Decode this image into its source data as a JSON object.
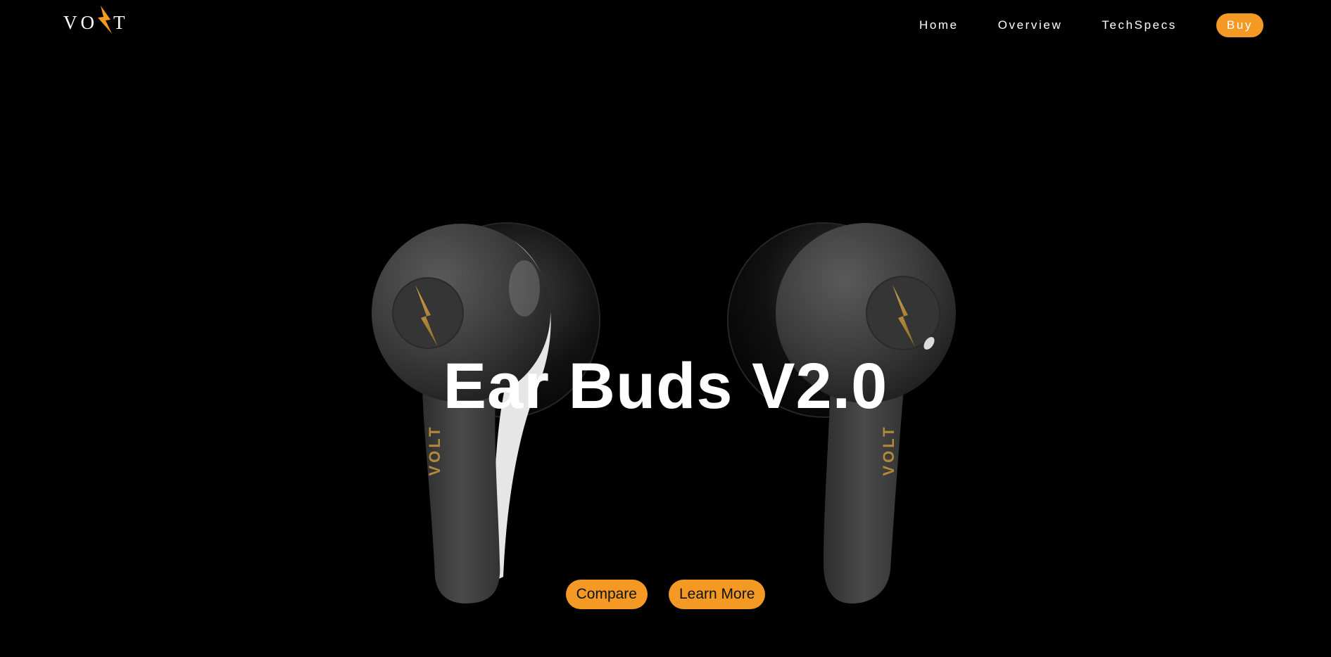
{
  "brand": {
    "logo_left": "VO",
    "logo_right": "T",
    "accent_color": "#f49a24"
  },
  "nav": {
    "items": [
      {
        "label": "Home"
      },
      {
        "label": "Overview"
      },
      {
        "label": "TechSpecs"
      }
    ],
    "buy_label": "Buy"
  },
  "hero": {
    "title": "Ear Buds V2.0",
    "earbud_engraving": "VOLT",
    "earbud_icon": "lightning-bolt-icon",
    "compare_label": "Compare",
    "learn_more_label": "Learn More"
  }
}
